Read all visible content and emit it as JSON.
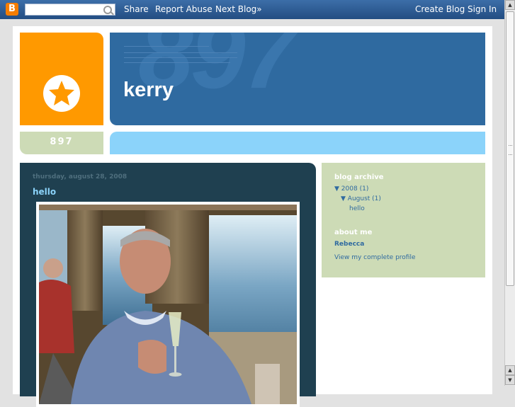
{
  "navbar": {
    "logo_glyph": "B",
    "search": {
      "value": "",
      "placeholder": ""
    },
    "share_label": "Share",
    "report_label": "Report Abuse",
    "next_blog_label": "Next Blog»",
    "create_blog_label": "Create Blog",
    "sign_in_label": "Sign In"
  },
  "header": {
    "watermark": "897",
    "title": "kerry",
    "logo_icon": "star-icon"
  },
  "subheader": {
    "label": "897"
  },
  "post": {
    "date": "thursday, august 28, 2008",
    "title": "hello"
  },
  "sidebar": {
    "archive_heading": "blog archive",
    "archive_year": "2008",
    "archive_year_count": "(1)",
    "archive_month": "August",
    "archive_month_count": "(1)",
    "archive_post": "hello",
    "about_heading": "about me",
    "profile_name": "Rebecca",
    "profile_link": "View my complete profile"
  },
  "scrollbar": {
    "up_icon": "arrow-up-icon",
    "down_icon": "arrow-down-icon"
  },
  "colors": {
    "navbar": "#2e5f98",
    "orange": "#ff9900",
    "header_blue": "#2f6aa0",
    "light_blue": "#8bd3fa",
    "sage": "#cddbb6",
    "post_panel": "#1f4050"
  }
}
